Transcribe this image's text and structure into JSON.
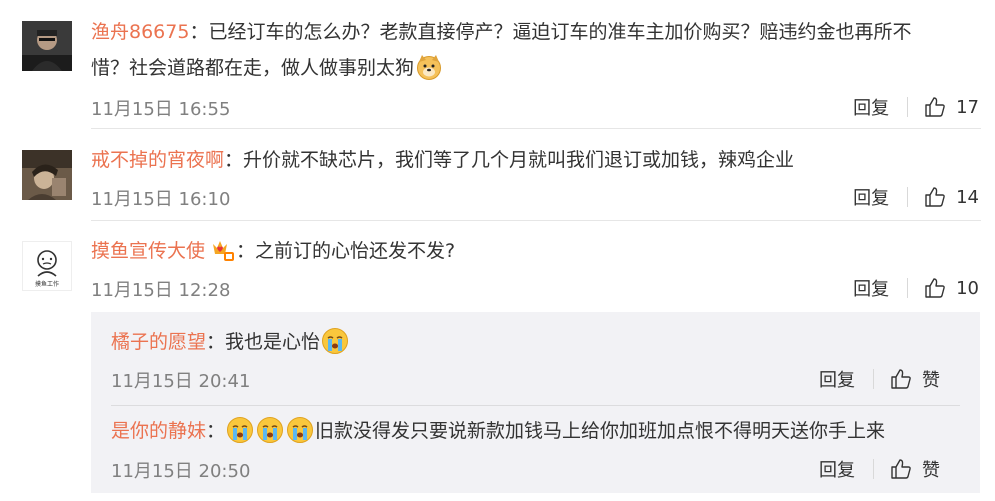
{
  "comments": [
    {
      "user": "渔舟86675",
      "colon": "：",
      "text_line1": "已经订车的怎么办？老款直接停产？逼迫订车的准车主加价购买？赔违约金也再所不",
      "text_line2": "惜？社会道路都在走，做人做事别太狗",
      "emoji": "doge-emoji",
      "time": "11月15日 16:55",
      "reply_label": "回复",
      "likes": "17"
    },
    {
      "user": "戒不掉的宵夜啊",
      "colon": "：",
      "text_line1": "升价就不缺芯片，我们等了几个月就叫我们退订或加钱，辣鸡企业",
      "time": "11月15日 16:10",
      "reply_label": "回复",
      "likes": "14"
    },
    {
      "user": "摸鱼宣传大使",
      "colon": "：",
      "badge": "fan-badge-icon",
      "text_line1": "之前订的心怡还发不发?",
      "time": "11月15日 12:28",
      "reply_label": "回复",
      "likes": "10",
      "avatar_text": "摸鱼工作"
    }
  ],
  "replies": [
    {
      "user": "橘子的愿望",
      "colon": "：",
      "text_line1": "我也是心怡",
      "emoji": "crying-emoji",
      "time": "11月15日 20:41",
      "reply_label": "回复",
      "like_label": "赞"
    },
    {
      "user": "是你的静妹",
      "colon": "：",
      "emoji_count": 3,
      "emoji": "crying-emoji",
      "text_line1": "旧款没得发只要说新款加钱马上给你加班加点恨不得明天送你手上来",
      "time": "11月15日 20:50",
      "reply_label": "回复",
      "like_label": "赞"
    }
  ],
  "colors": {
    "username": "#eb7350",
    "meta": "#808080",
    "reply_bg": "#f2f2f5"
  }
}
